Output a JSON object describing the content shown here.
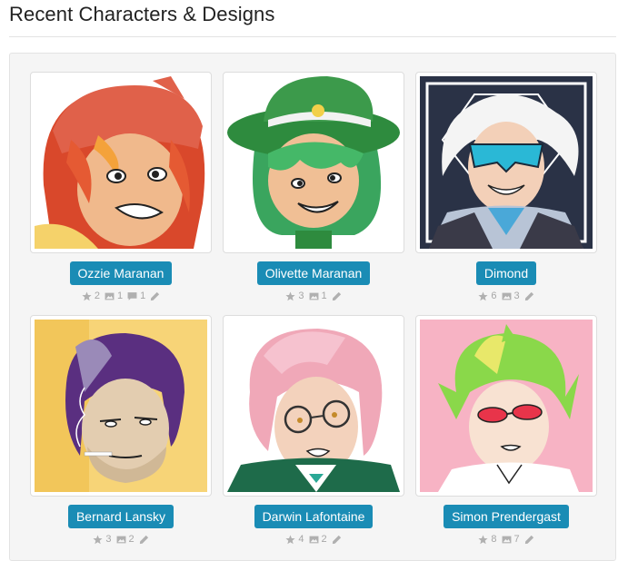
{
  "header": {
    "title": "Recent Characters & Designs"
  },
  "characters": [
    {
      "name": "Ozzie Maranan",
      "stars": "2",
      "images": "1",
      "comments": "1"
    },
    {
      "name": "Olivette Maranan",
      "stars": "3",
      "images": "1"
    },
    {
      "name": "Dimond",
      "stars": "6",
      "images": "3"
    },
    {
      "name": "Bernard Lansky",
      "stars": "3",
      "images": "2"
    },
    {
      "name": "Darwin Lafontaine",
      "stars": "4",
      "images": "2"
    },
    {
      "name": "Simon Prendergast",
      "stars": "8",
      "images": "7"
    }
  ],
  "icons": {
    "star": "star-icon",
    "image": "image-icon",
    "comment": "comment-icon",
    "edit": "pencil-icon"
  },
  "colors": {
    "button": "#1a8cb5",
    "panel_bg": "#f5f5f5",
    "stat_gray": "#a6a6a6"
  }
}
